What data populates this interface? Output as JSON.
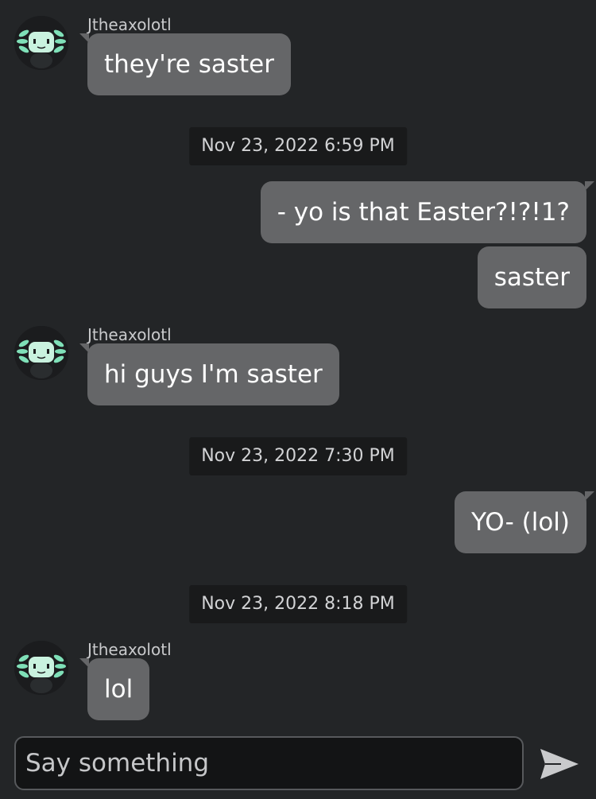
{
  "messages": [
    {
      "type": "incoming",
      "username": "Jtheaxolotl",
      "text": "they're saster"
    },
    {
      "type": "timestamp",
      "text": "Nov 23, 2022 6:59 PM"
    },
    {
      "type": "outgoing",
      "text": "- yo is that Easter?!?!1?"
    },
    {
      "type": "outgoing",
      "text": "saster"
    },
    {
      "type": "incoming",
      "username": "Jtheaxolotl",
      "text": "hi guys I'm saster"
    },
    {
      "type": "timestamp",
      "text": "Nov 23, 2022 7:30 PM"
    },
    {
      "type": "outgoing",
      "text": "YO- (lol)"
    },
    {
      "type": "timestamp",
      "text": "Nov 23, 2022 8:18 PM"
    },
    {
      "type": "incoming",
      "username": "Jtheaxolotl",
      "text": "lol"
    }
  ],
  "composer": {
    "placeholder": "Say something"
  },
  "icons": {
    "avatar": "axolotl-avatar-icon",
    "send": "send-arrow-icon"
  },
  "colors": {
    "background": "#232527",
    "bubble": "#656668",
    "timestamp_bg": "#191a1b",
    "avatar_accent": "#7fe0b8"
  }
}
